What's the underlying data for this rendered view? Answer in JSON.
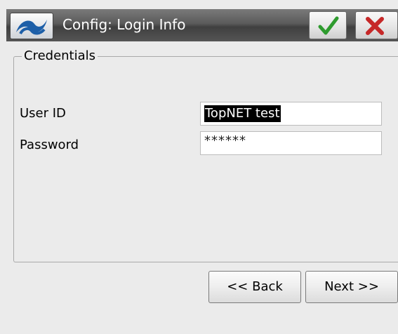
{
  "window": {
    "title": "Config: Login Info",
    "ok_icon": "checkmark-icon",
    "cancel_icon": "close-x-icon",
    "logo_icon": "app-logo-icon"
  },
  "credentials": {
    "group_label": "Credentials",
    "user_id_label": "User ID",
    "user_id_value": "TopNET test",
    "password_label": "Password",
    "password_value": "******"
  },
  "nav": {
    "back_label": "<< Back",
    "next_label": "Next >>"
  },
  "colors": {
    "ok": "#2e9b2e",
    "cancel": "#c62828",
    "logo": "#1d5fa8"
  }
}
